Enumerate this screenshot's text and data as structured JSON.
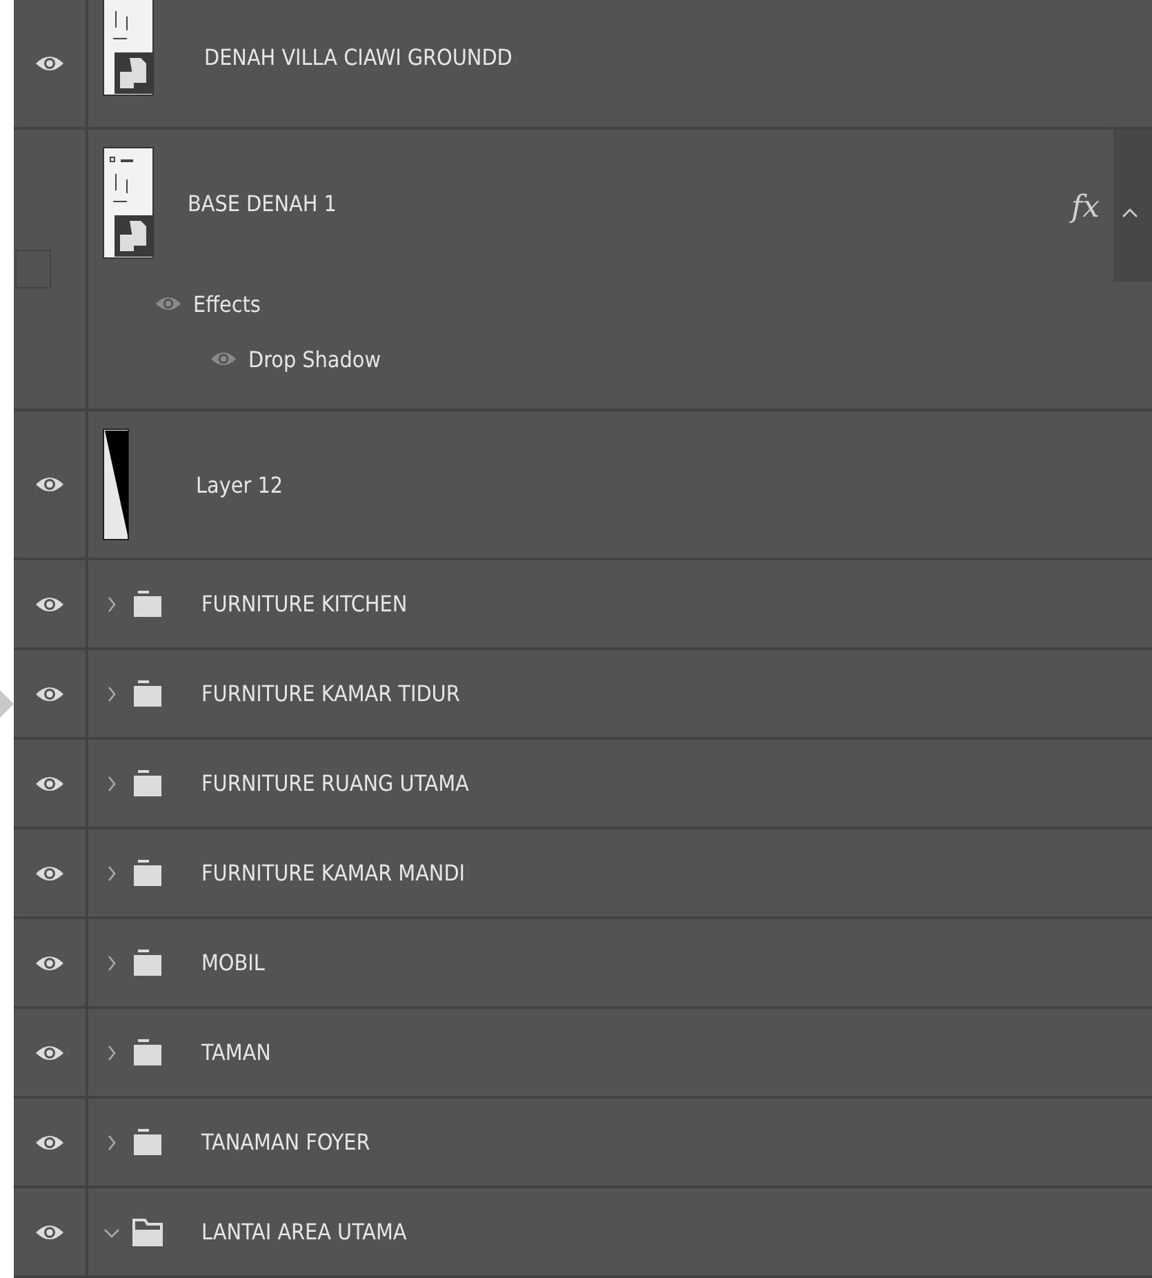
{
  "layers": [
    {
      "kind": "smart",
      "name": "DENAH VILLA CIAWI GROUNDD",
      "visible": true
    },
    {
      "kind": "smart",
      "name": "BASE DENAH 1",
      "visible": false,
      "fx": true,
      "fx_label": "fx",
      "effects": {
        "label": "Effects",
        "visible": true,
        "items": [
          {
            "name": "Drop Shadow",
            "visible": true
          }
        ]
      }
    },
    {
      "kind": "pixel",
      "name": "Layer 12",
      "visible": true
    },
    {
      "kind": "group",
      "name": "FURNITURE KITCHEN",
      "visible": true,
      "expanded": false
    },
    {
      "kind": "group",
      "name": "FURNITURE KAMAR TIDUR",
      "visible": true,
      "expanded": false
    },
    {
      "kind": "group",
      "name": "FURNITURE RUANG UTAMA",
      "visible": true,
      "expanded": false
    },
    {
      "kind": "group",
      "name": "FURNITURE KAMAR MANDI",
      "visible": true,
      "expanded": false
    },
    {
      "kind": "group",
      "name": "MOBIL",
      "visible": true,
      "expanded": false
    },
    {
      "kind": "group",
      "name": "TAMAN",
      "visible": true,
      "expanded": false
    },
    {
      "kind": "group",
      "name": "TANAMAN FOYER",
      "visible": true,
      "expanded": false
    },
    {
      "kind": "group",
      "name": "LANTAI AREA UTAMA",
      "visible": true,
      "expanded": true
    }
  ]
}
